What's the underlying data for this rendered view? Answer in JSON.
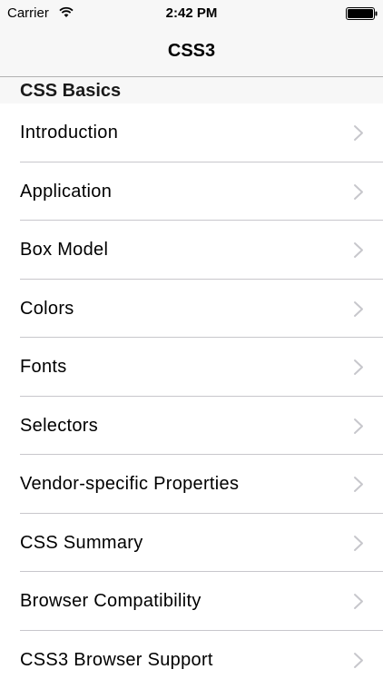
{
  "status_bar": {
    "carrier": "Carrier",
    "time": "2:42 PM",
    "wifi_icon": "wifi-icon",
    "battery_icon": "battery-icon"
  },
  "nav": {
    "title": "CSS3"
  },
  "section": {
    "title": "CSS Basics"
  },
  "list": {
    "accessory_icon": "chevron-right-icon",
    "items": [
      {
        "label": "Introduction"
      },
      {
        "label": "Application"
      },
      {
        "label": "Box Model"
      },
      {
        "label": "Colors"
      },
      {
        "label": "Fonts"
      },
      {
        "label": "Selectors"
      },
      {
        "label": "Vendor-specific Properties"
      },
      {
        "label": "CSS Summary"
      },
      {
        "label": "Browser Compatibility"
      },
      {
        "label": "CSS3 Browser Support"
      }
    ]
  },
  "colors": {
    "bar_background": "#f7f7f7",
    "separator": "#c8c7cc",
    "chevron": "#c7c7cc"
  }
}
